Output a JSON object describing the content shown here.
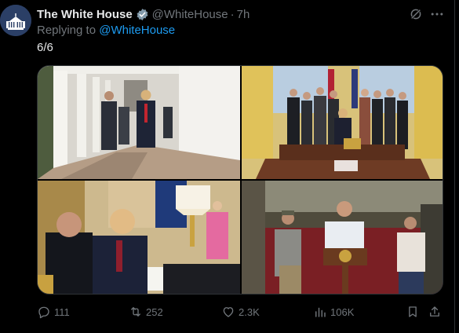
{
  "author": {
    "name": "The White House",
    "handle": "@WhiteHouse",
    "time": "7h",
    "verified": true,
    "badge_color": "#829aab"
  },
  "reply": {
    "prefix": "Replying to",
    "target": "@WhiteHouse"
  },
  "tweet": {
    "text": "6/6"
  },
  "photos": [
    {
      "subject": "colonnade-walk"
    },
    {
      "subject": "oval-office-group"
    },
    {
      "subject": "oval-office-meeting"
    },
    {
      "subject": "podium-remarks"
    }
  ],
  "stats": {
    "replies": "111",
    "retweets": "252",
    "likes": "2.3K",
    "views": "106K"
  },
  "icons": {
    "reply": "reply-icon",
    "retweet": "retweet-icon",
    "like": "heart-icon",
    "views": "views-icon",
    "bookmark": "bookmark-icon",
    "share": "share-icon",
    "grok": "grok-icon",
    "more": "more-icon"
  },
  "colors": {
    "link": "#1d9bf0",
    "muted": "#71767b",
    "text": "#e7e9ea",
    "background": "#000000"
  }
}
